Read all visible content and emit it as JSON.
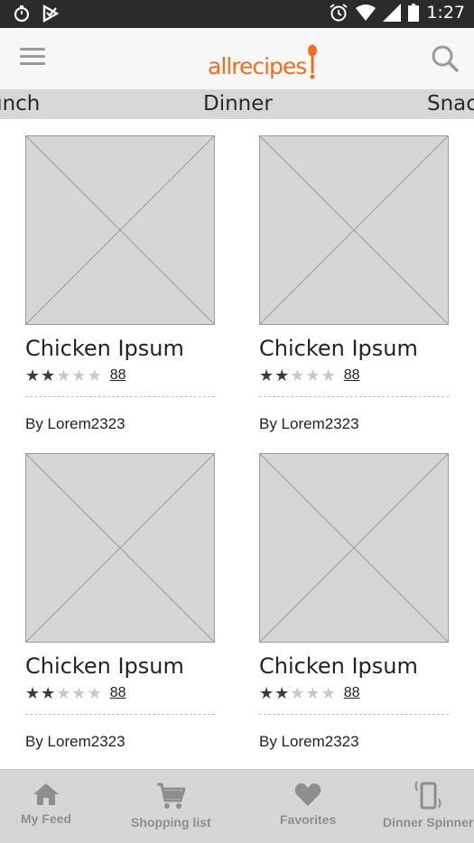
{
  "status_bar": {
    "time": "1:27"
  },
  "header": {
    "logo_text": "allrecipes",
    "brand_color": "#f26d21"
  },
  "tabs": [
    {
      "label": "Lunch",
      "visible_text": "unch"
    },
    {
      "label": "Dinner",
      "visible_text": "Dinner",
      "selected": true
    },
    {
      "label": "Snacks",
      "visible_text": "Snac"
    }
  ],
  "recipes": [
    {
      "title": "Chicken Ipsum",
      "rating": 2,
      "max_rating": 5,
      "review_count": "88",
      "author": "By Lorem2323"
    },
    {
      "title": "Chicken Ipsum",
      "rating": 2,
      "max_rating": 5,
      "review_count": "88",
      "author": "By Lorem2323"
    },
    {
      "title": "Chicken Ipsum",
      "rating": 2,
      "max_rating": 5,
      "review_count": "88",
      "author": "By Lorem2323"
    },
    {
      "title": "Chicken Ipsum",
      "rating": 2,
      "max_rating": 5,
      "review_count": "88",
      "author": "By Lorem2323"
    }
  ],
  "bottom_nav": [
    {
      "label": "My Feed",
      "icon": "home-icon"
    },
    {
      "label": "Shopping list",
      "icon": "cart-icon"
    },
    {
      "label": "Favorites",
      "icon": "heart-icon"
    },
    {
      "label": "Dinner Spinner",
      "icon": "phone-shake-icon"
    }
  ]
}
